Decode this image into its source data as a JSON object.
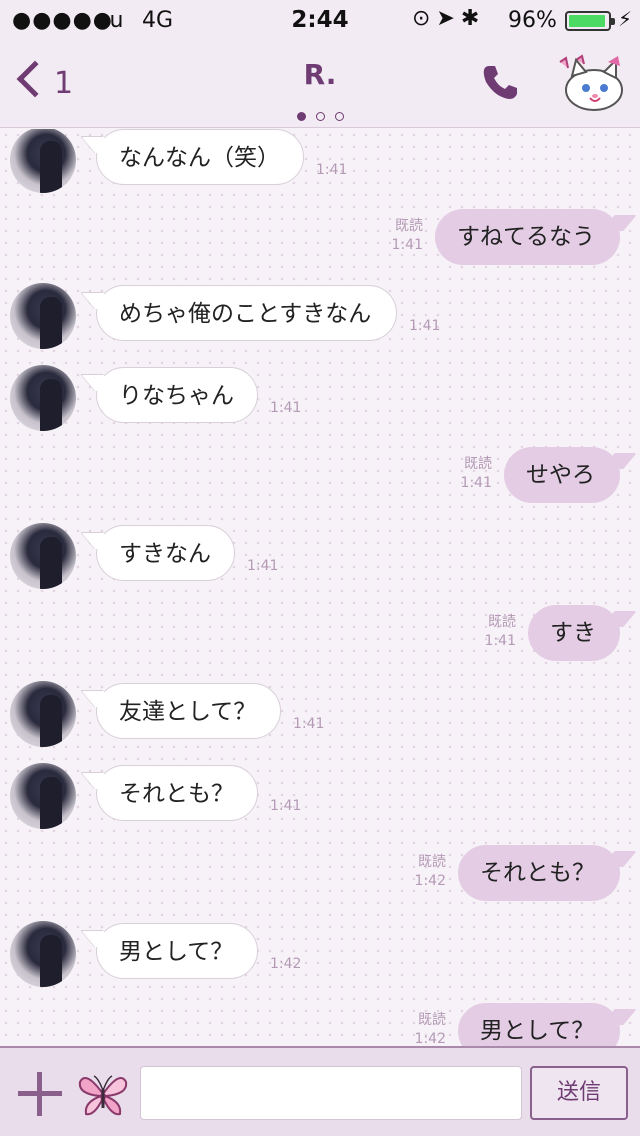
{
  "status_bar": {
    "signal": "●●●●●",
    "carrier": "au",
    "network": "4G",
    "time": "2:44",
    "icons": "⊙➤✱",
    "battery": "96%",
    "battery_level": 0.96,
    "charging_icon": "⚡"
  },
  "header": {
    "back_count": "1",
    "title": "R.",
    "page_count": 3,
    "active_page": 1,
    "icons": [
      "back-chevron-icon",
      "phone-icon",
      "cat-sticker-menu-icon"
    ]
  },
  "colors": {
    "accent": "#6e3b72",
    "outgoing_bubble": "#e3cce4",
    "incoming_bubble": "#ffffff",
    "meta_text": "#b49ab6"
  },
  "messages": [
    {
      "side": "in",
      "text": "なんなん（笑）",
      "time": "1:41"
    },
    {
      "side": "out",
      "text": "すねてるなう",
      "read": "既読",
      "time": "1:41"
    },
    {
      "side": "in",
      "text": "めちゃ俺のことすきなん",
      "time": "1:41"
    },
    {
      "side": "in",
      "text": "りなちゃん",
      "time": "1:41"
    },
    {
      "side": "out",
      "text": "せやろ",
      "read": "既読",
      "time": "1:41"
    },
    {
      "side": "in",
      "text": "すきなん",
      "time": "1:41"
    },
    {
      "side": "out",
      "text": "すき",
      "read": "既読",
      "time": "1:41"
    },
    {
      "side": "in",
      "text": "友達として？",
      "time": "1:41"
    },
    {
      "side": "in",
      "text": "それとも？",
      "time": "1:41"
    },
    {
      "side": "out",
      "text": "それとも？",
      "read": "既読",
      "time": "1:42"
    },
    {
      "side": "in",
      "text": "男として？",
      "time": "1:42"
    },
    {
      "side": "out",
      "text": "男として？",
      "read": "既読",
      "time": "1:42"
    }
  ],
  "input_bar": {
    "placeholder": "",
    "send_label": "送信",
    "icons": [
      "plus-icon",
      "butterfly-sticker-icon"
    ]
  }
}
